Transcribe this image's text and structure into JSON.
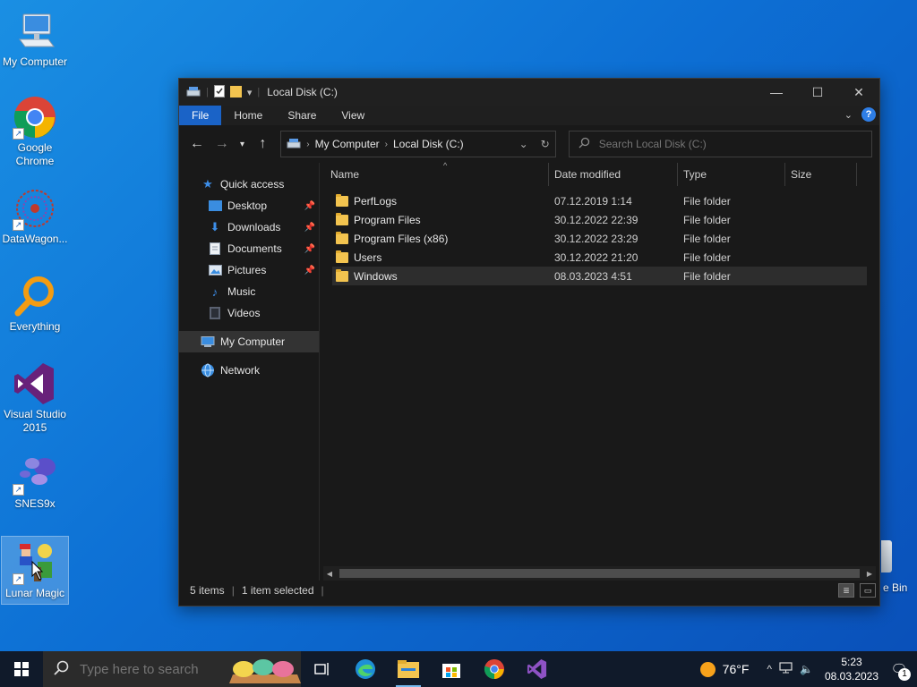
{
  "desktop": {
    "icons": [
      {
        "label": "My Computer",
        "icon": "computer-icon"
      },
      {
        "label": "Google Chrome",
        "icon": "chrome-icon"
      },
      {
        "label": "DataWagon...",
        "icon": "datawagon-icon"
      },
      {
        "label": "Everything",
        "icon": "everything-search-icon"
      },
      {
        "label": "Visual Studio 2015",
        "icon": "visual-studio-icon"
      },
      {
        "label": "SNES9x",
        "icon": "snes9x-icon"
      },
      {
        "label": "Lunar Magic",
        "icon": "lunar-magic-icon"
      }
    ],
    "recycle_bin_partial_label": "e Bin"
  },
  "window": {
    "title": "Local Disk (C:)",
    "ribbon_tabs": [
      "File",
      "Home",
      "Share",
      "View"
    ],
    "address": {
      "segments": [
        "My Computer",
        "Local Disk (C:)"
      ]
    },
    "search_placeholder": "Search Local Disk (C:)",
    "nav": {
      "quick_access": "Quick access",
      "quick_items": [
        {
          "label": "Desktop",
          "pinned": true
        },
        {
          "label": "Downloads",
          "pinned": true
        },
        {
          "label": "Documents",
          "pinned": true
        },
        {
          "label": "Pictures",
          "pinned": true
        },
        {
          "label": "Music",
          "pinned": false
        },
        {
          "label": "Videos",
          "pinned": false
        }
      ],
      "my_computer": "My Computer",
      "network": "Network"
    },
    "columns": {
      "name": "Name",
      "date": "Date modified",
      "type": "Type",
      "size": "Size"
    },
    "files": [
      {
        "name": "PerfLogs",
        "date": "07.12.2019 1:14",
        "type": "File folder"
      },
      {
        "name": "Program Files",
        "date": "30.12.2022 22:39",
        "type": "File folder"
      },
      {
        "name": "Program Files (x86)",
        "date": "30.12.2022 23:29",
        "type": "File folder"
      },
      {
        "name": "Users",
        "date": "30.12.2022 21:20",
        "type": "File folder"
      },
      {
        "name": "Windows",
        "date": "08.03.2023 4:51",
        "type": "File folder"
      }
    ],
    "status": {
      "items": "5 items",
      "selected": "1 item selected"
    }
  },
  "taskbar": {
    "search_placeholder": "Type here to search",
    "weather": "76°F",
    "time": "5:23",
    "date": "08.03.2023",
    "notification_count": "1"
  },
  "colors": {
    "accent": "#1a63c7",
    "window_bg": "#191919",
    "folder": "#f3c44f",
    "taskbar": "#101a2a"
  }
}
